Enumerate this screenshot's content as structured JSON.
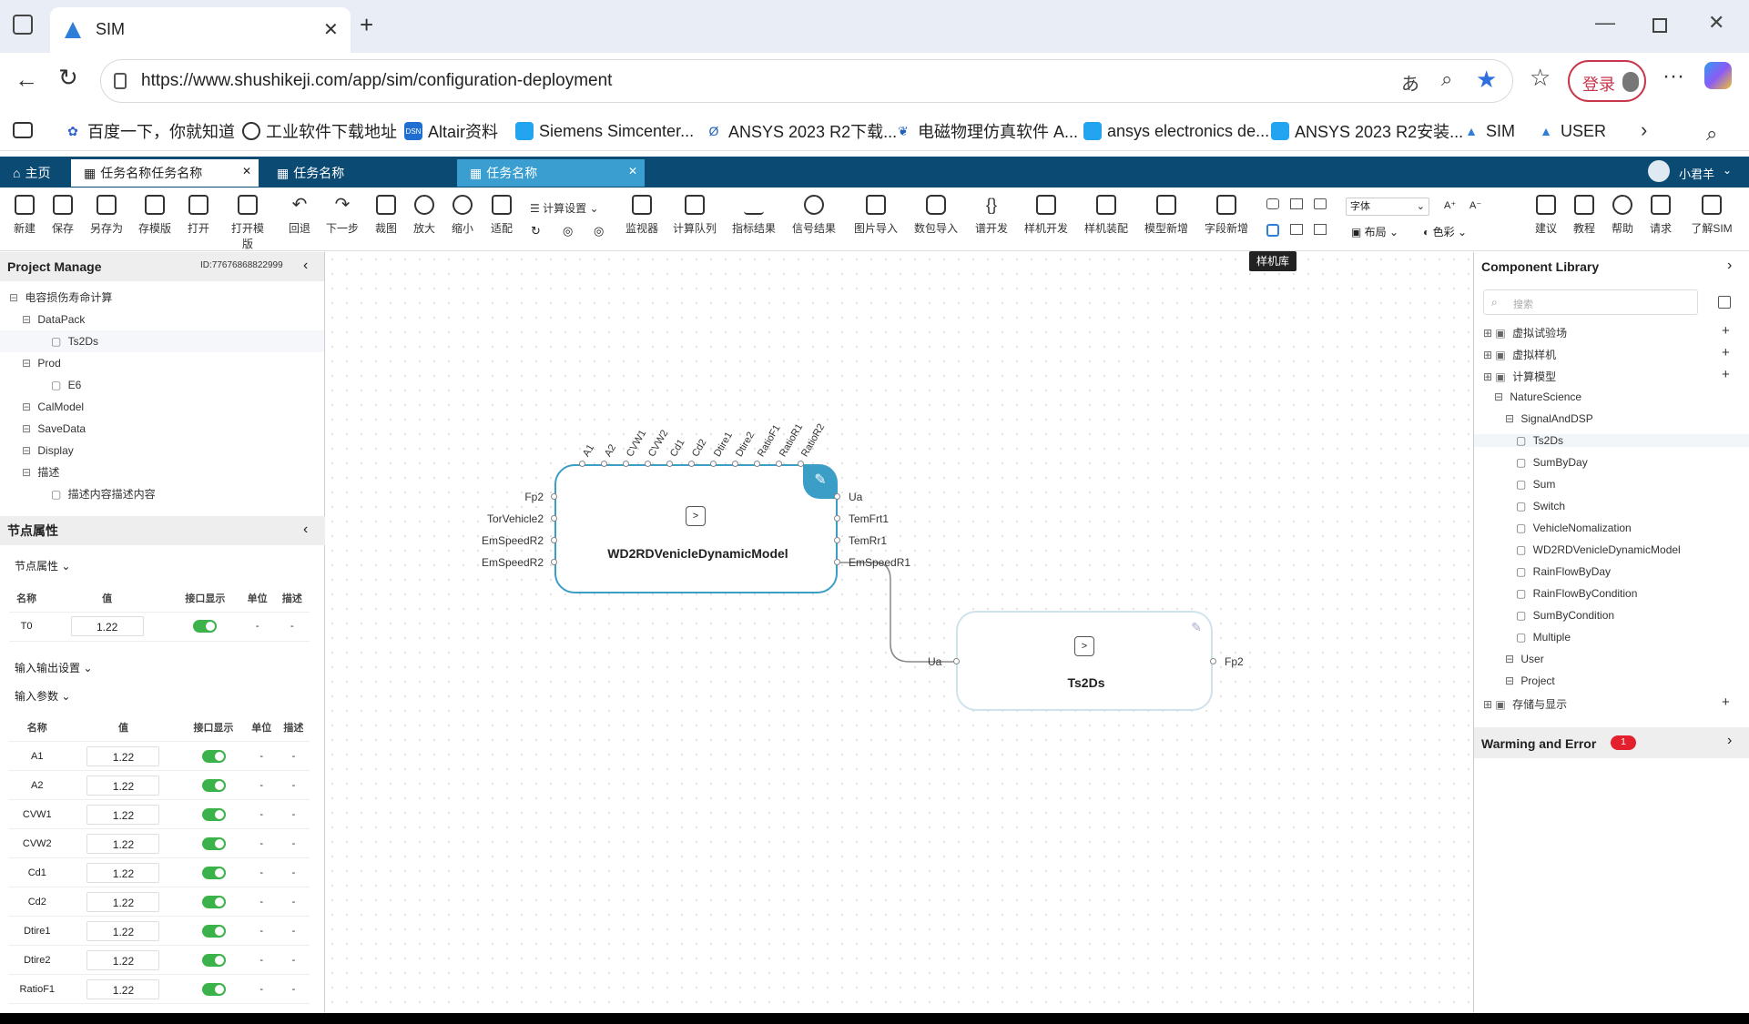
{
  "browser": {
    "tab_title": "SIM",
    "url": "https://www.shushikeji.com/app/sim/configuration-deployment",
    "login_label": "登录",
    "bookmarks": [
      "百度一下，你就知道",
      "工业软件下载地址",
      "Altair资料",
      "Siemens Simcenter...",
      "ANSYS 2023 R2下载...",
      "电磁物理仿真软件 A...",
      "ansys electronics de...",
      "ANSYS 2023 R2安装...",
      "SIM",
      "USER"
    ]
  },
  "app_tabs": {
    "home": "主页",
    "tab1": "任务名称任务名称",
    "tab2": "任务名称",
    "tab3": "任务名称",
    "user": "小君羊"
  },
  "toolbar": {
    "items": [
      "新建",
      "保存",
      "另存为",
      "存模版",
      "打开",
      "打开模版",
      "回退",
      "下一步",
      "裁图",
      "放大",
      "缩小",
      "适配"
    ],
    "calc_settings": "计算设置",
    "items2": [
      "监视器",
      "计算队列",
      "指标结果",
      "信号结果",
      "图片导入",
      "数包导入",
      "谱开发",
      "样机开发",
      "样机装配",
      "模型新增",
      "字段新增"
    ],
    "font_label": "字体",
    "layout_label": "布局",
    "color_label": "色彩",
    "items3": [
      "建议",
      "教程",
      "帮助",
      "请求",
      "了解SIM"
    ],
    "tooltip": "样机库"
  },
  "project": {
    "title": "Project Manage",
    "id": "ID:77676868822999",
    "tree": [
      {
        "label": "电容损伤寿命计算",
        "level": 0
      },
      {
        "label": "DataPack",
        "level": 1
      },
      {
        "label": "Ts2Ds",
        "level": 2
      },
      {
        "label": "Prod",
        "level": 1
      },
      {
        "label": "E6",
        "level": 2
      },
      {
        "label": "CalModel",
        "level": 1
      },
      {
        "label": "SaveData",
        "level": 1
      },
      {
        "label": "Display",
        "level": 1
      },
      {
        "label": "描述",
        "level": 1
      },
      {
        "label": "描述内容描述内容",
        "level": 2
      }
    ]
  },
  "node_props": {
    "title": "节点属性",
    "section1": "节点属性",
    "headers": [
      "名称",
      "值",
      "接口显示",
      "单位",
      "描述"
    ],
    "rows1": [
      {
        "name": "T0",
        "value": "1.22",
        "unit": "-",
        "desc": "-"
      }
    ],
    "section2": "输入输出设置",
    "section3": "输入参数",
    "rows2": [
      {
        "name": "A1",
        "value": "1.22",
        "unit": "-",
        "desc": "-"
      },
      {
        "name": "A2",
        "value": "1.22",
        "unit": "-",
        "desc": "-"
      },
      {
        "name": "CVW1",
        "value": "1.22",
        "unit": "-",
        "desc": "-"
      },
      {
        "name": "CVW2",
        "value": "1.22",
        "unit": "-",
        "desc": "-"
      },
      {
        "name": "Cd1",
        "value": "1.22",
        "unit": "-",
        "desc": "-"
      },
      {
        "name": "Cd2",
        "value": "1.22",
        "unit": "-",
        "desc": "-"
      },
      {
        "name": "Dtire1",
        "value": "1.22",
        "unit": "-",
        "desc": "-"
      },
      {
        "name": "Dtire2",
        "value": "1.22",
        "unit": "-",
        "desc": "-"
      },
      {
        "name": "RatioF1",
        "value": "1.22",
        "unit": "-",
        "desc": "-"
      }
    ]
  },
  "canvas": {
    "node1": {
      "title": "WD2RDVenicleDynamicModel",
      "top_ports": [
        "A1",
        "A2",
        "CVW1",
        "CVW2",
        "Cd1",
        "Cd2",
        "Dtire1",
        "Dtire2",
        "RatioF1",
        "RatioR1",
        "RatioR2"
      ],
      "left_ports": [
        "Fp2",
        "TorVehicle2",
        "EmSpeedR2",
        "EmSpeedR2"
      ],
      "right_ports": [
        "Ua",
        "TemFrt1",
        "TemRr1",
        "EmSpeedR1"
      ]
    },
    "node2": {
      "title": "Ts2Ds",
      "left_port": "Ua",
      "right_port": "Fp2"
    }
  },
  "library": {
    "title": "Component Library",
    "search_placeholder": "搜索",
    "items": [
      {
        "label": "虚拟试验场",
        "level": 0
      },
      {
        "label": "虚拟样机",
        "level": 0
      },
      {
        "label": "计算模型",
        "level": 0
      },
      {
        "label": "NatureScience",
        "level": 1
      },
      {
        "label": "SignalAndDSP",
        "level": 2
      },
      {
        "label": "Ts2Ds",
        "level": 3
      },
      {
        "label": "SumByDay",
        "level": 3
      },
      {
        "label": "Sum",
        "level": 3
      },
      {
        "label": "Switch",
        "level": 3
      },
      {
        "label": "VehicleNomalization",
        "level": 3
      },
      {
        "label": "WD2RDVenicleDynamicModel",
        "level": 3
      },
      {
        "label": "RainFlowByDay",
        "level": 3
      },
      {
        "label": "RainFlowByCondition",
        "level": 3
      },
      {
        "label": "SumByCondition",
        "level": 3
      },
      {
        "label": "Multiple",
        "level": 3
      },
      {
        "label": "User",
        "level": 2
      },
      {
        "label": "Project",
        "level": 2
      },
      {
        "label": "存储与显示",
        "level": 0
      }
    ],
    "warn_title": "Warming and Error",
    "warn_count": "1"
  }
}
